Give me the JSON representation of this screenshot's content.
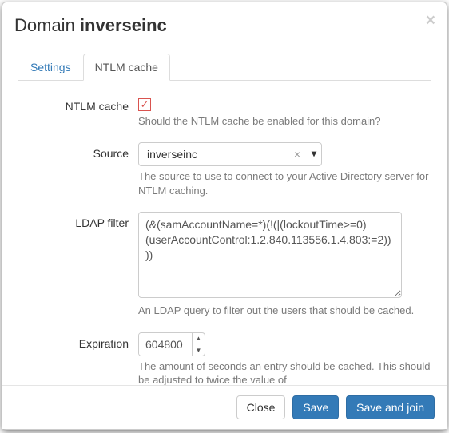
{
  "header": {
    "title_prefix": "Domain ",
    "title_name": "inverseinc"
  },
  "tabs": {
    "settings": "Settings",
    "ntlm_cache": "NTLM cache"
  },
  "form": {
    "ntlm_cache": {
      "label": "NTLM cache",
      "checked": true,
      "help": "Should the NTLM cache be enabled for this domain?"
    },
    "source": {
      "label": "Source",
      "value": "inverseinc",
      "help": "The source to use to connect to your Active Directory server for NTLM caching."
    },
    "ldap_filter": {
      "label": "LDAP filter",
      "value": "(&(samAccountName=*)(!(|(lockoutTime>=0)(userAccountControl:1.2.840.113556.1.4.803:=2))))",
      "help": "An LDAP query to filter out the users that should be cached."
    },
    "expiration": {
      "label": "Expiration",
      "value": "604800",
      "help": "The amount of seconds an entry should be cached. This should be adjusted to twice the value of maintenance.populate_ntlm_redis_cache_interval if using"
    }
  },
  "footer": {
    "close": "Close",
    "save": "Save",
    "save_join": "Save and join"
  }
}
